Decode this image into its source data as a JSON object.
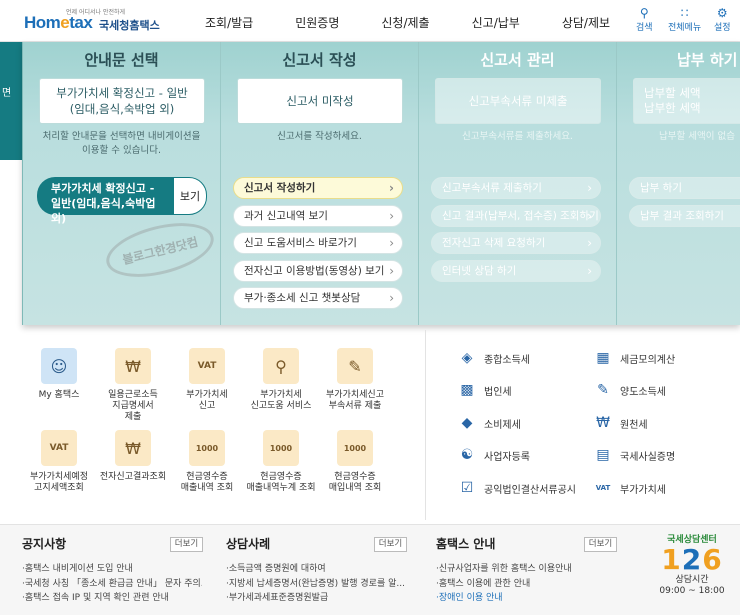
{
  "header": {
    "logo_brand": "Hometax",
    "logo_tag": "언제 어디서나 안전하게",
    "logo_kr": "국세청홈택스",
    "nav": [
      "조회/발급",
      "민원증명",
      "신청/제출",
      "신고/납부",
      "상담/제보"
    ],
    "util": [
      {
        "icon": "search-icon",
        "label": "검색"
      },
      {
        "icon": "grid-menu-icon",
        "label": "전체메뉴"
      },
      {
        "icon": "gear-icon",
        "label": "설정"
      }
    ]
  },
  "leftedge": {
    "label": "면"
  },
  "mega": {
    "guide": {
      "title": "안내문 선택",
      "box": "부가가치세 확정신고 - 일반\n(임대,음식,숙박업 외)",
      "desc": "처리할 안내문을 선택하면 내비게이션을\n이용할 수 있습니다.",
      "selected": "부가가치세 확정신고 - 일반(임대,음식,숙박업 외)",
      "view_btn": "보기",
      "stamp": "블로그한경닷컴"
    },
    "report": {
      "title": "신고서 작성",
      "box": "신고서 미작성",
      "desc": "신고서를 작성하세요.",
      "links": [
        "신고서 작성하기",
        "과거 신고내역 보기",
        "신고 도움서비스 바로가기",
        "전자신고 이용방법(동영상) 보기",
        "부가·종소세 신고 챗봇상담"
      ]
    },
    "manage": {
      "title": "신고서 관리",
      "box": "신고부속서류 미제출",
      "desc": "신고부속서류를 제출하세요.",
      "links": [
        "신고부속서류 제출하기",
        "신고 결과(납부서, 접수증) 조회하기",
        "전자신고 삭제 요청하기",
        "인터넷 상담 하기"
      ]
    },
    "pay": {
      "title": "납부 하기",
      "box": "납부할 세액\n납부한 세액",
      "desc": "납부할 세액이 없습",
      "links": [
        "납부 하기",
        "납부 결과 조회하기"
      ]
    }
  },
  "quick_icons": [
    {
      "label": "My 홈택스",
      "icon": "user-icon"
    },
    {
      "label": "일용근로소득\n지급명세서\n제출",
      "icon": "won-document-icon"
    },
    {
      "label": "부가가치세\n신고",
      "icon": "vat-document-icon"
    },
    {
      "label": "부가가치세\n신고도움 서비스",
      "icon": "vat-search-icon"
    },
    {
      "label": "부가가치세신고\n부속서류 제출",
      "icon": "document-edit-icon"
    },
    {
      "label": "부가가치세예정\n고지세액조회",
      "icon": "vat-notice-icon"
    },
    {
      "label": "전자신고결과조회",
      "icon": "won-search-icon"
    },
    {
      "label": "현금영수증\n매출내역 조회",
      "icon": "receipt-1000-icon"
    },
    {
      "label": "현금영수증\n매출내역누계 조회",
      "icon": "receipt-1000-icon"
    },
    {
      "label": "현금영수증\n매입내역 조회",
      "icon": "receipt-1000-icon"
    }
  ],
  "tax_links": [
    {
      "label": "종합소득세",
      "icon": "money-bag-icon"
    },
    {
      "label": "세금모의계산",
      "icon": "calculator-icon"
    },
    {
      "label": "법인세",
      "icon": "building-icon"
    },
    {
      "label": "양도소득세",
      "icon": "contract-icon"
    },
    {
      "label": "소비제세",
      "icon": "diamond-icon"
    },
    {
      "label": "원천세",
      "icon": "won-document-icon"
    },
    {
      "label": "사업자등록",
      "icon": "person-icon"
    },
    {
      "label": "국세사실증명",
      "icon": "certificate-icon"
    },
    {
      "label": "공익법인결산서류공시",
      "icon": "clipboard-icon"
    },
    {
      "label": "부가가치세",
      "icon": "vat-icon"
    }
  ],
  "bottom": {
    "notice": {
      "title": "공지사항",
      "more": "더보기",
      "items": [
        "홈택스 내비게이션 도입 안내",
        "국세청 사칭 「종소세 환급금 안내」 문자 주의...",
        "홈택스 접속 IP 및 지역 확인 관련 안내"
      ]
    },
    "cases": {
      "title": "상담사례",
      "more": "더보기",
      "items": [
        "소득금액 증명원에 대하여",
        "지방세 납세증명서(완납증명) 발행 경로를 알...",
        "부가세과세표준증명원발급"
      ]
    },
    "hometax": {
      "title": "홈택스 안내",
      "more": "더보기",
      "items": [
        "신규사업자를 위한 홈택스 이용안내",
        "홈택스 이용에 관한 안내",
        "장애인 이용 안내"
      ]
    },
    "center": {
      "title": "국세상담센터",
      "number": "126",
      "hours_label": "상담시간",
      "hours": "09:00 ~ 18:00"
    }
  }
}
